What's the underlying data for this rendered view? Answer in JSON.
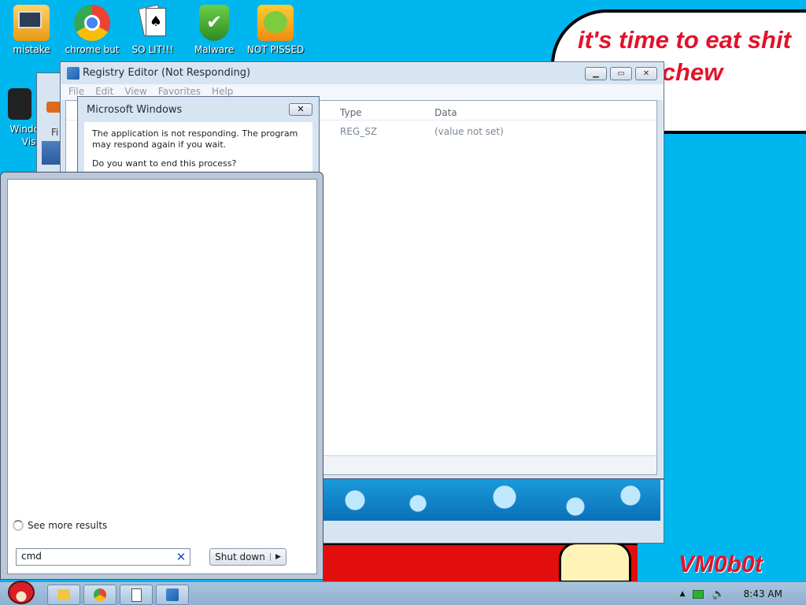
{
  "desktop": {
    "icons": [
      {
        "label": "mistake",
        "icon": "monitor-warning-icon",
        "color": "#f0b030"
      },
      {
        "label": "chrome but",
        "icon": "chrome-icon",
        "color": "#ea4335"
      },
      {
        "label": "SO LIT!!!",
        "icon": "solitaire-cards-icon",
        "color": "#ffffff"
      },
      {
        "label": "Malware",
        "icon": "shield-check-icon",
        "color": "#4caf50"
      },
      {
        "label": "NOT PISSED",
        "icon": "bad-piggies-icon",
        "color": "#f5a623"
      },
      {
        "label": "Windo\nVist",
        "icon": "bin-icon",
        "color": "#333333"
      }
    ],
    "bubble_text": "it's time to eat shit\n     and chew\n    gum",
    "signature": "VM0b0t"
  },
  "registry_window": {
    "title": "Registry Editor (Not Responding)",
    "menu": [
      "File",
      "Edit",
      "View",
      "Favorites",
      "Help"
    ],
    "columns": [
      "Type",
      "Data"
    ],
    "row": {
      "type": "REG_SZ",
      "data": "(value not set)"
    }
  },
  "background_window": {
    "menu_fragment": "Fi"
  },
  "dialog": {
    "title": "Microsoft Windows",
    "message": "The application is not responding. The program may respond again if you wait.",
    "question": "Do you want to end this process?",
    "close_glyph": "✕"
  },
  "start_menu": {
    "see_more": "See more results",
    "search_value": "cmd",
    "search_clear_glyph": "✕",
    "shutdown_label": "Shut down",
    "shutdown_arrow": "▶"
  },
  "taskbar": {
    "items": [
      "explorer-icon",
      "chrome-icon",
      "solitaire-icon",
      "registry-icon"
    ],
    "tray": {
      "chevron": "▲",
      "time": "8:43 AM"
    }
  }
}
